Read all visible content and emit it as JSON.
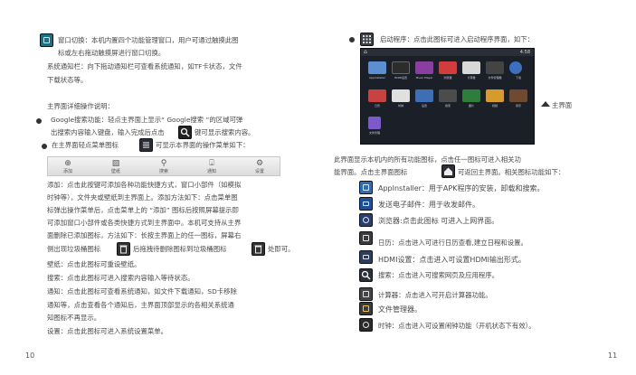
{
  "left": {
    "window_switch": [
      "窗口切换：本机内置四个功能管理窗口，用户可通过触摸此图",
      "标或左右拖动触摸屏进行窗口切换。"
    ],
    "notification_bar": [
      "系统通知栏：向下拖动通知栏可查看系统通知，如TF卡状态，文件",
      "下载状态等。"
    ],
    "main_section_title": "主界面详细操作说明：",
    "google_search": [
      "Google搜索功能：轻点主界面上显示“ Google搜索 ”的区域可弹",
      "出搜索内容输入键盘，输入完成后点击",
      "键可显示搜索内容。"
    ],
    "menu_intro": [
      "在主界面轻点菜单图标",
      "可显示本界面的操作菜单如下："
    ],
    "toolbar": [
      {
        "icon": "plus-icon",
        "label": "添加"
      },
      {
        "icon": "wallpaper-icon",
        "label": "壁纸"
      },
      {
        "icon": "search-icon",
        "label": "搜索"
      },
      {
        "icon": "notification-icon",
        "label": "通知"
      },
      {
        "icon": "settings-icon",
        "label": "设置"
      }
    ],
    "add_text": [
      "添加：点击此按键可添加各种功能快捷方式，窗口小部件（如模拟",
      "时钟等），文件夹或壁纸到主界面上。添加方法如下：点击菜单图",
      "标弹出操作菜单后，点击菜单上的 “添加” 图标后按照屏幕提示即",
      "可添加窗口小部件或各类快捷方式到主界面中。本机可支持从主界",
      "面删除已添加图标，方法如下：长按主界面上的任一图标，屏幕右",
      "侧出现垃圾桶图标",
      "后拖拽待删除图标到垃圾桶图标",
      "处即可。"
    ],
    "wallpaper_text": "壁纸：点击此图标可重设壁纸。",
    "search_text": "搜索：点击此图标可进入搜索内容输入等待状态。",
    "notify_text": [
      "通知：点击此图标可查看系统通知，如文件下载通知，SD卡移除",
      "通知等，点击查看各个通知后，主界面顶部显示的各相关系统通",
      "知图标不再显示。"
    ],
    "settings_text": "设置：点击此图标可进入系统设置菜单。",
    "page_number": "10"
  },
  "right": {
    "launcher": "启动程序：点击此图标可进入启动程序界面，如下：",
    "home_label": "主界面",
    "screen_status": "4:58",
    "screen_apps": [
      "AppInstaller",
      "HDMI设置",
      "Music Player",
      "浏览器",
      "计算器",
      "文件管理器",
      "日历",
      "时钟",
      "设置",
      "搜索",
      "图片",
      "视频",
      "下载",
      "音乐",
      "文件管理",
      "邮件",
      "搜索"
    ],
    "desc": [
      "此界面显示本机内的所有功能图标，点击任一图标可进入相关功",
      "能界面。点击主界面图标",
      "可返回主界面。相关图标功能如下："
    ],
    "items": [
      {
        "icon": "app-installer-icon",
        "text": "AppInstaller：用于APK程序的安装，卸载和搜索。"
      },
      {
        "icon": "email-icon",
        "text": "发送电子邮件：用于收发邮件。"
      },
      {
        "icon": "browser-icon",
        "text": "浏览器:点击此图标 可进入上网界面。"
      },
      {
        "icon": "calendar-icon",
        "text": "日历：点击进入可进行日历查看,建立日程和设置。"
      },
      {
        "icon": "hdmi-icon",
        "text": "HDMI设置：点击进入可设置HDMI输出形式。"
      },
      {
        "icon": "search-app-icon",
        "text": "搜索：点击进入可搜索网页及应用程序。"
      },
      {
        "icon": "calculator-icon",
        "text": "计算器：点击进入可开启计算器功能。"
      },
      {
        "icon": "file-manager-icon",
        "text": "文件管理器。"
      },
      {
        "icon": "clock-icon",
        "text": "时钟：点击进入可设置闹钟功能（开机状态下有效）。"
      }
    ],
    "page_number": "11"
  },
  "colors": {
    "text": "#4a4a4a",
    "toolbar_bg": "#e6e6e6",
    "screen_bg": "#1b1f28"
  }
}
